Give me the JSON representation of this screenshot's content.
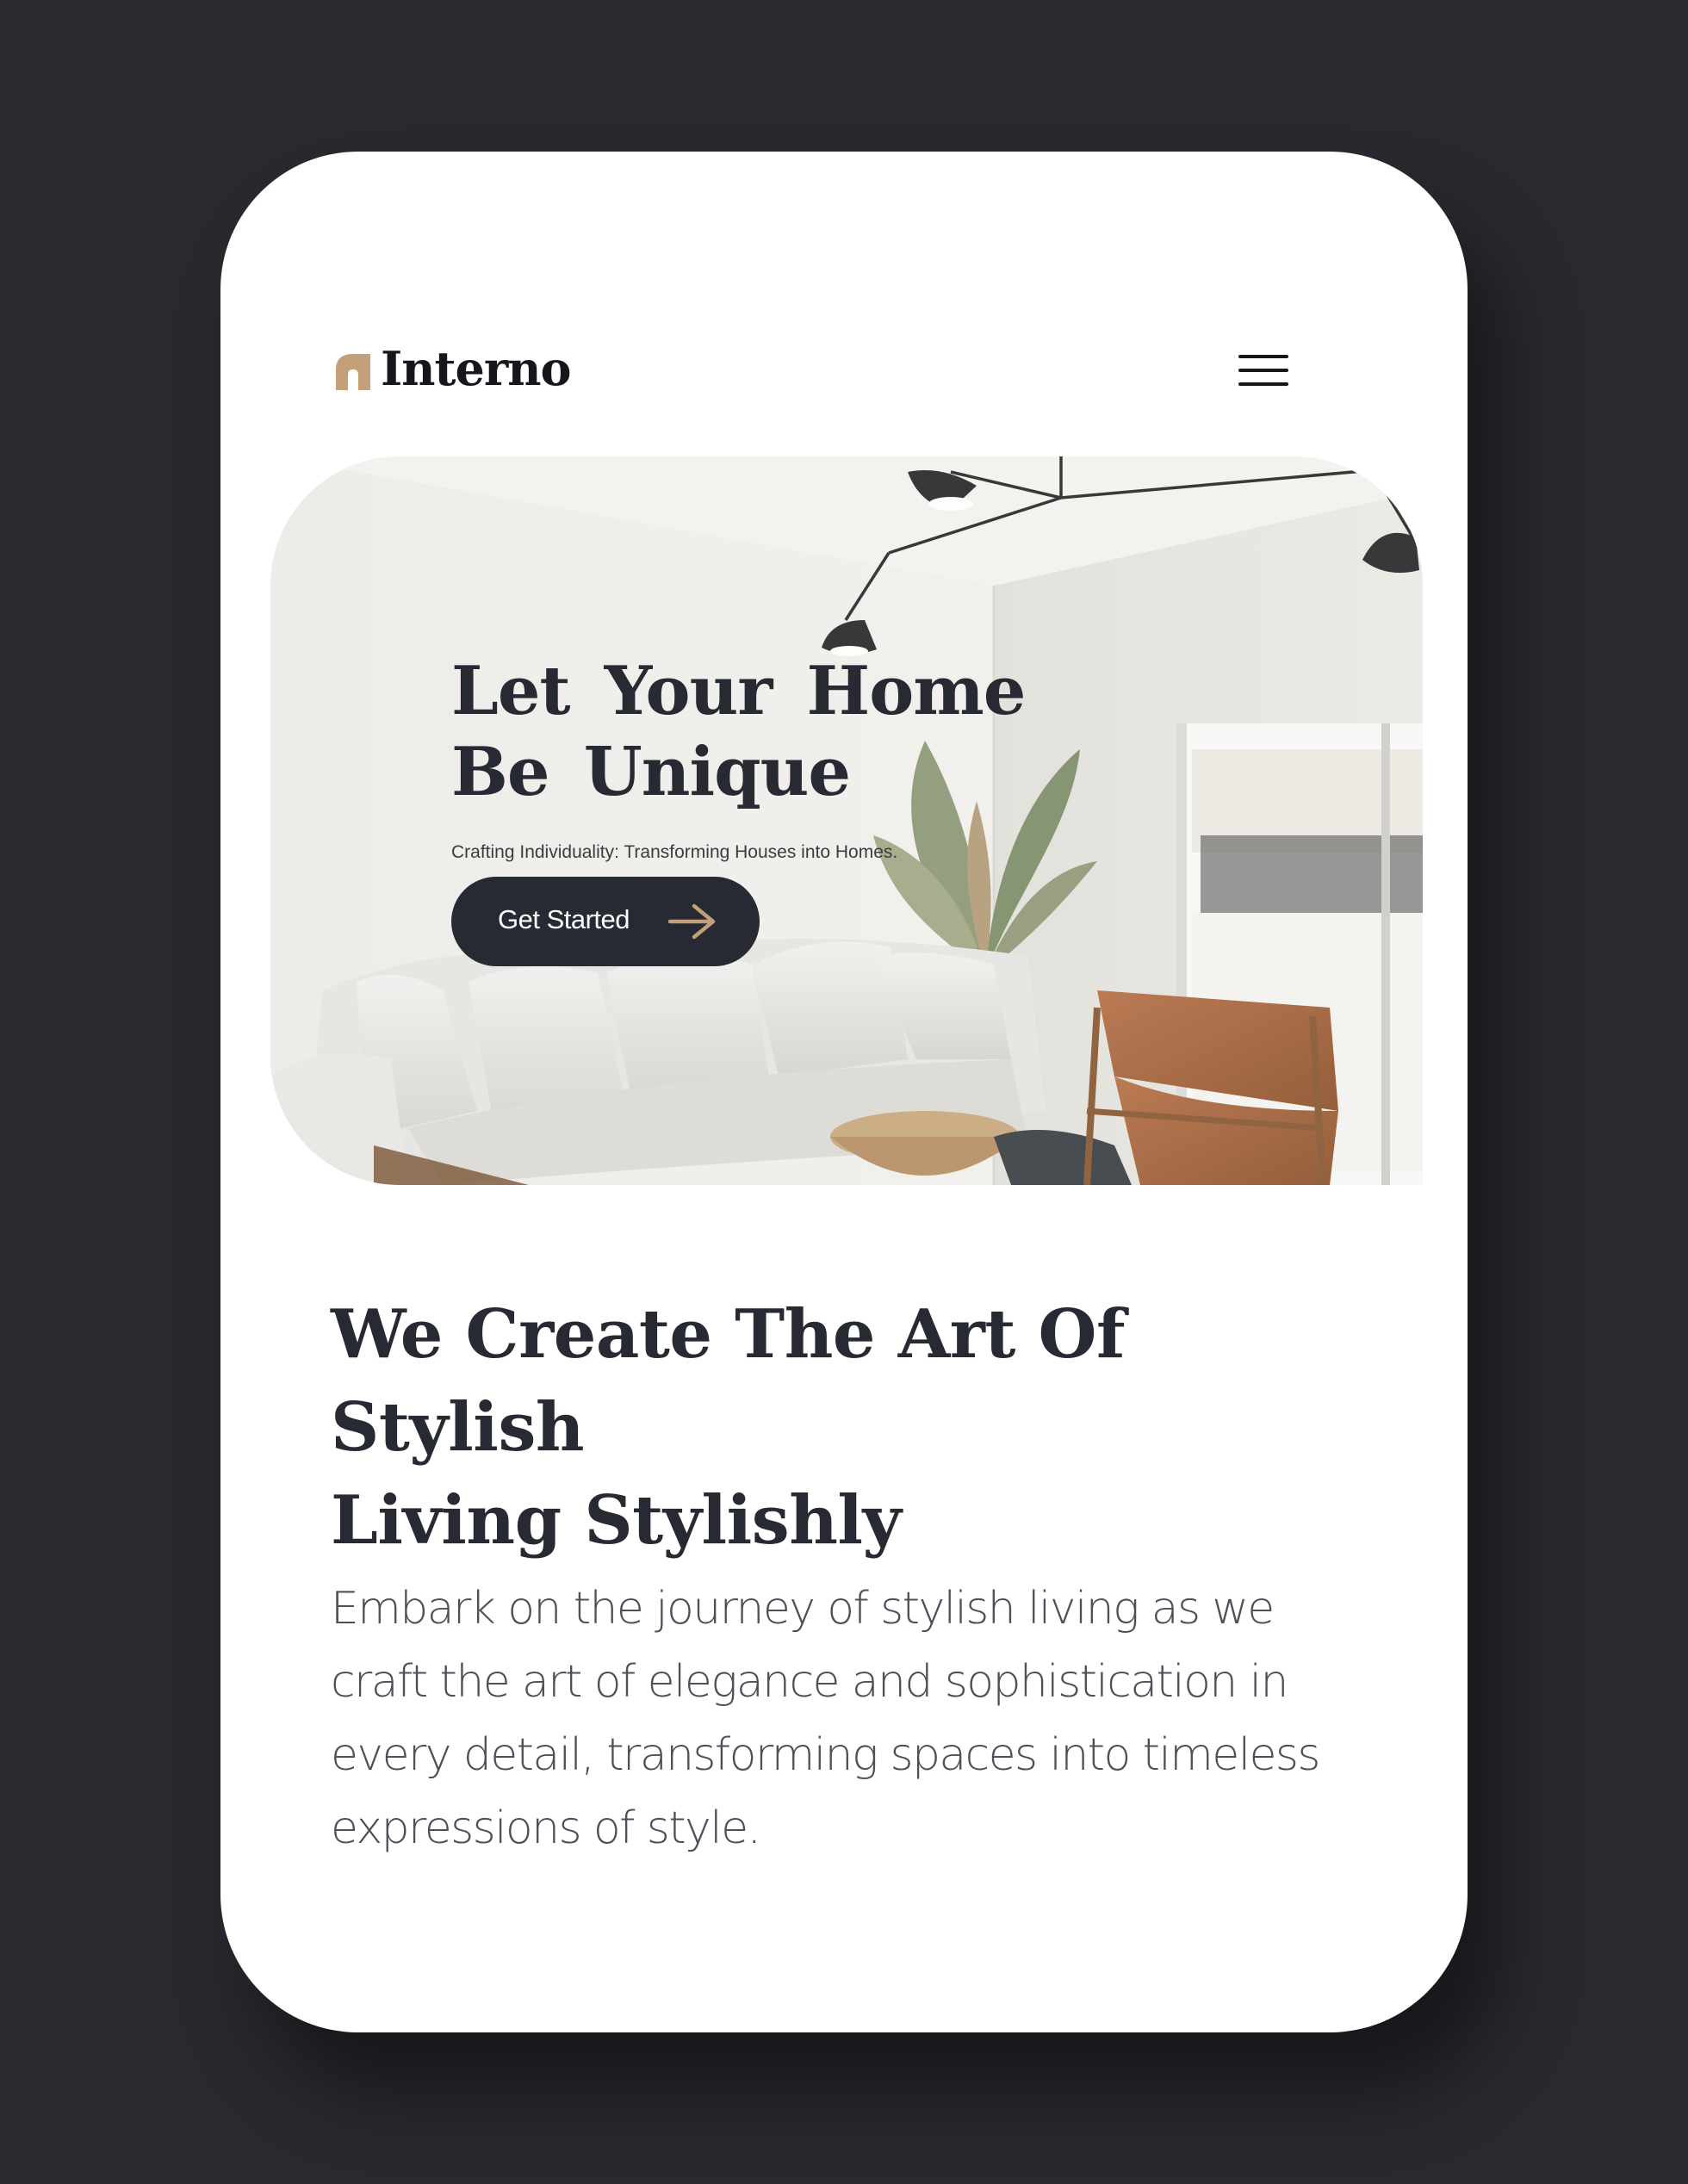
{
  "header": {
    "brand": "Interno",
    "menu_icon": "hamburger-menu-icon"
  },
  "hero": {
    "title_line1": "Let Your Home",
    "title_line2": "Be Unique",
    "subtitle": "Crafting Individuality: Transforming Houses into Homes.",
    "cta_label": "Get Started",
    "cta_icon": "arrow-right-icon"
  },
  "section": {
    "title_line1": "We Create The Art Of Stylish",
    "title_line2": "Living Stylishly",
    "body": "Embark on the journey of stylish living as we craft the art of elegance and sophistication in every detail, transforming spaces into timeless expressions of style."
  },
  "colors": {
    "page_background": "#292a30",
    "card_background": "#ffffff",
    "primary_dark": "#272a33",
    "accent": "#c4a07a",
    "body_text": "#4d5058"
  }
}
